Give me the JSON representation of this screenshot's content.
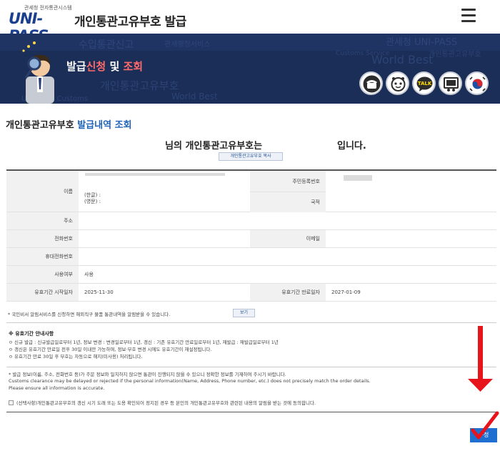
{
  "header": {
    "logo_small": "관세청 전자통관시스템",
    "logo_main": "UNI-PASS",
    "title": "개인통관고유부호 발급",
    "menu_icon": "hamburger-menu-icon"
  },
  "banner": {
    "title_part1": "발급",
    "title_part2": "신청",
    "title_part3": " 및 ",
    "title_part4": "조회",
    "icons": [
      "phone-icon",
      "chatbot-icon",
      "talk-icon",
      "presentation-icon",
      "korea-emblem-icon"
    ],
    "talk_label": "TALK"
  },
  "section": {
    "title_black": "개인통관고유부호 ",
    "title_blue": "발급내역 조회"
  },
  "headline": {
    "left": "님의 개인통관고유부호는",
    "right": "입니다.",
    "copy_button": "개인통관고유부호 복사"
  },
  "info": {
    "name_label": "이름",
    "name_kor": "(한글) :",
    "name_eng": "(영문) :",
    "rrn_label": "주민등록번호",
    "nation_label": "국적",
    "address_label": "주소",
    "phone_label": "전화번호",
    "email_label": "이메일",
    "mobile_label": "휴대전화번호",
    "usage_label": "사용여부",
    "usage_value": "사용",
    "start_label": "유효기간 시작일자",
    "start_value": "2025-11-30",
    "end_label": "유효기간 만료일자",
    "end_value": "2027-01-09"
  },
  "notice": {
    "text": "* 국민비서 알림서비스를 신청하면 해외직구 물품 통관내역을 알림받을 수 있습니다.",
    "view_button": "보기"
  },
  "guide": {
    "title": "※ 유효기간 안내사항",
    "lines": [
      "ㅇ 신규 발급 : 신규발급일로부터 1년, 정보 변경 : 변경일로부터 1년, 갱신 : 기존 유효기간 만료일로부터 1년, 재발급 : 재발급일로부터 1년",
      "ㅇ 갱신은 유효기간 만료일 전후 30일 이내만 가능하며, 정보·부호 변경 시에도 유효기간이 재설정됩니다.",
      "ㅇ 유효기간 만료 30일 후 부호는 자동으로 해지(미사용) 처리됩니다."
    ]
  },
  "warning": {
    "line1": "* 발급 정보(이름, 주소, 전화번호 등)가 주문 정보와 일치하지 않으면 통관이 진행되지 않을 수 있으니 정확한 정보를 기재하여 주시기 바랍니다.",
    "line2": "Customs clearance may be delayed or rejected if the personal information(Name, Address, Phone number, etc.) does not precisely match the order details.",
    "line3": "Please ensure all information is accurate."
  },
  "agree": {
    "text": "(선택사항)개인통관고유부호의 갱신 시기 도래 또는 도용 확인되어 정지된 경우 등 본인의 개인통관고유부호와 관련된 내용의 알림을 받는 것에 동의합니다."
  },
  "submit": {
    "label": "수정"
  },
  "colors": {
    "banner": "#1b2e58",
    "accent_blue": "#1e62b8",
    "button_blue": "#1f6fd0",
    "annotation_red": "#e8141b"
  }
}
